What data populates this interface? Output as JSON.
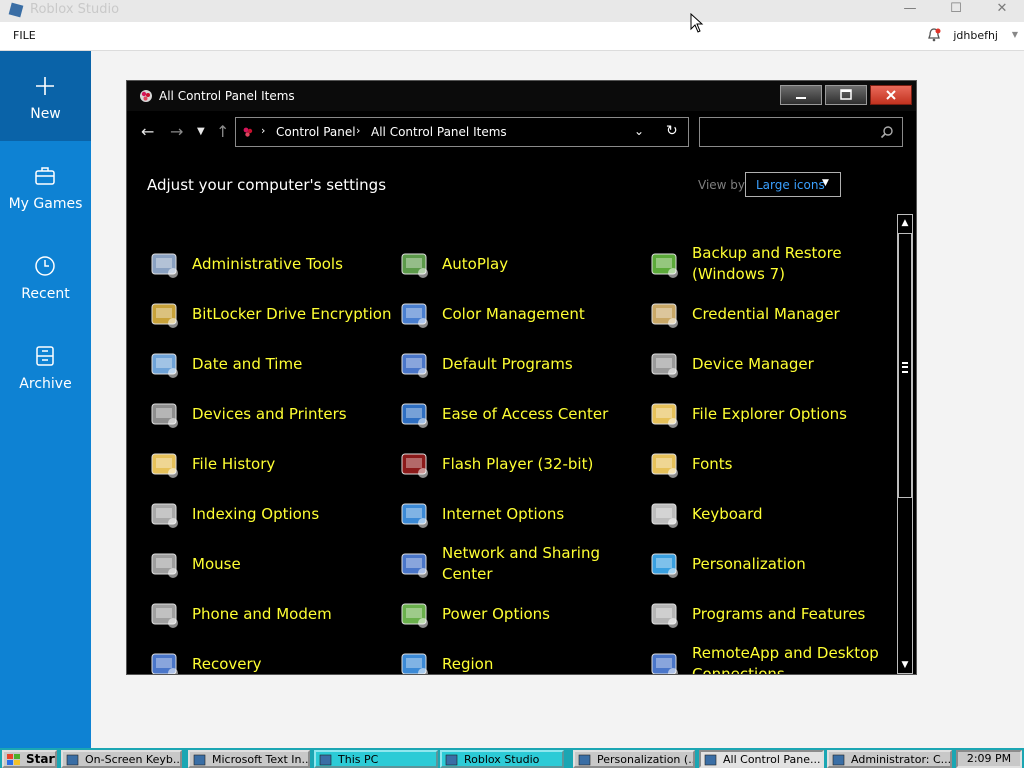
{
  "app": {
    "title": "Roblox Studio",
    "menu_file": "FILE",
    "user": "jdhbefhj",
    "window_buttons": [
      "—",
      "☐",
      "✕"
    ]
  },
  "sidebar": {
    "items": [
      {
        "label": "New",
        "icon": "plus-icon",
        "active": true
      },
      {
        "label": "My Games",
        "icon": "briefcase-icon",
        "active": false
      },
      {
        "label": "Recent",
        "icon": "clock-icon",
        "active": false
      },
      {
        "label": "Archive",
        "icon": "archive-icon",
        "active": false
      }
    ]
  },
  "cp": {
    "title": "All Control Panel Items",
    "breadcrumb": [
      "Control Panel",
      "All Control Panel Items"
    ],
    "search_placeholder": "",
    "heading": "Adjust your computer's settings",
    "view_by_label": "View by:",
    "view_by_value": "Large icons",
    "items": [
      {
        "label": "Administrative Tools",
        "icon": "admin-tools-icon",
        "color": "#8aa1c1"
      },
      {
        "label": "AutoPlay",
        "icon": "autoplay-icon",
        "color": "#5c9a4a"
      },
      {
        "label": "Backup and Restore (Windows 7)",
        "icon": "backup-restore-icon",
        "color": "#5caa3a"
      },
      {
        "label": "BitLocker Drive Encryption",
        "icon": "bitlocker-icon",
        "color": "#c8a23a"
      },
      {
        "label": "Color Management",
        "icon": "color-management-icon",
        "color": "#4a7fd0"
      },
      {
        "label": "Credential Manager",
        "icon": "credential-manager-icon",
        "color": "#c9a867"
      },
      {
        "label": "Date and Time",
        "icon": "date-time-icon",
        "color": "#6fa3d8"
      },
      {
        "label": "Default Programs",
        "icon": "default-programs-icon",
        "color": "#4a76c9"
      },
      {
        "label": "Device Manager",
        "icon": "device-manager-icon",
        "color": "#9a9a9a"
      },
      {
        "label": "Devices and Printers",
        "icon": "devices-printers-icon",
        "color": "#8e8e8e"
      },
      {
        "label": "Ease of Access Center",
        "icon": "ease-of-access-icon",
        "color": "#2f6fc2"
      },
      {
        "label": "File Explorer Options",
        "icon": "file-explorer-options-icon",
        "color": "#e6c15a"
      },
      {
        "label": "File History",
        "icon": "file-history-icon",
        "color": "#e6c15a"
      },
      {
        "label": "Flash Player (32-bit)",
        "icon": "flash-player-icon",
        "color": "#8b1a1a"
      },
      {
        "label": "Fonts",
        "icon": "fonts-icon",
        "color": "#e6c15a"
      },
      {
        "label": "Indexing Options",
        "icon": "indexing-options-icon",
        "color": "#a8a8a8"
      },
      {
        "label": "Internet Options",
        "icon": "internet-options-icon",
        "color": "#3c8ad6"
      },
      {
        "label": "Keyboard",
        "icon": "keyboard-icon",
        "color": "#bdbdbd"
      },
      {
        "label": "Mouse",
        "icon": "mouse-icon",
        "color": "#9e9e9e"
      },
      {
        "label": "Network and Sharing Center",
        "icon": "network-sharing-icon",
        "color": "#4a76c9"
      },
      {
        "label": "Personalization",
        "icon": "personalization-icon",
        "color": "#3aa0e0"
      },
      {
        "label": "Phone and Modem",
        "icon": "phone-modem-icon",
        "color": "#a0a0a0"
      },
      {
        "label": "Power Options",
        "icon": "power-options-icon",
        "color": "#6ab04c"
      },
      {
        "label": "Programs and Features",
        "icon": "programs-features-icon",
        "color": "#b5b5b5"
      },
      {
        "label": "Recovery",
        "icon": "recovery-icon",
        "color": "#4a76c9"
      },
      {
        "label": "Region",
        "icon": "region-icon",
        "color": "#3c8ad6"
      },
      {
        "label": "RemoteApp and Desktop Connections",
        "icon": "remoteapp-icon",
        "color": "#4a76c9"
      }
    ]
  },
  "taskbar": {
    "start": "Start",
    "tasks": [
      {
        "label": "On-Screen Keyb...",
        "icon": "keyboard-icon"
      },
      {
        "label": "Microsoft Text In...",
        "icon": "text-input-icon"
      },
      {
        "label": "This PC",
        "icon": "folder-icon"
      },
      {
        "label": "Roblox Studio",
        "icon": "roblox-icon"
      },
      {
        "label": "Personalization (...",
        "icon": "personalization-icon"
      },
      {
        "label": "All Control Pane...",
        "icon": "control-panel-icon"
      },
      {
        "label": "Administrator: C...",
        "icon": "cmd-icon"
      }
    ],
    "clock": "2:09 PM"
  }
}
